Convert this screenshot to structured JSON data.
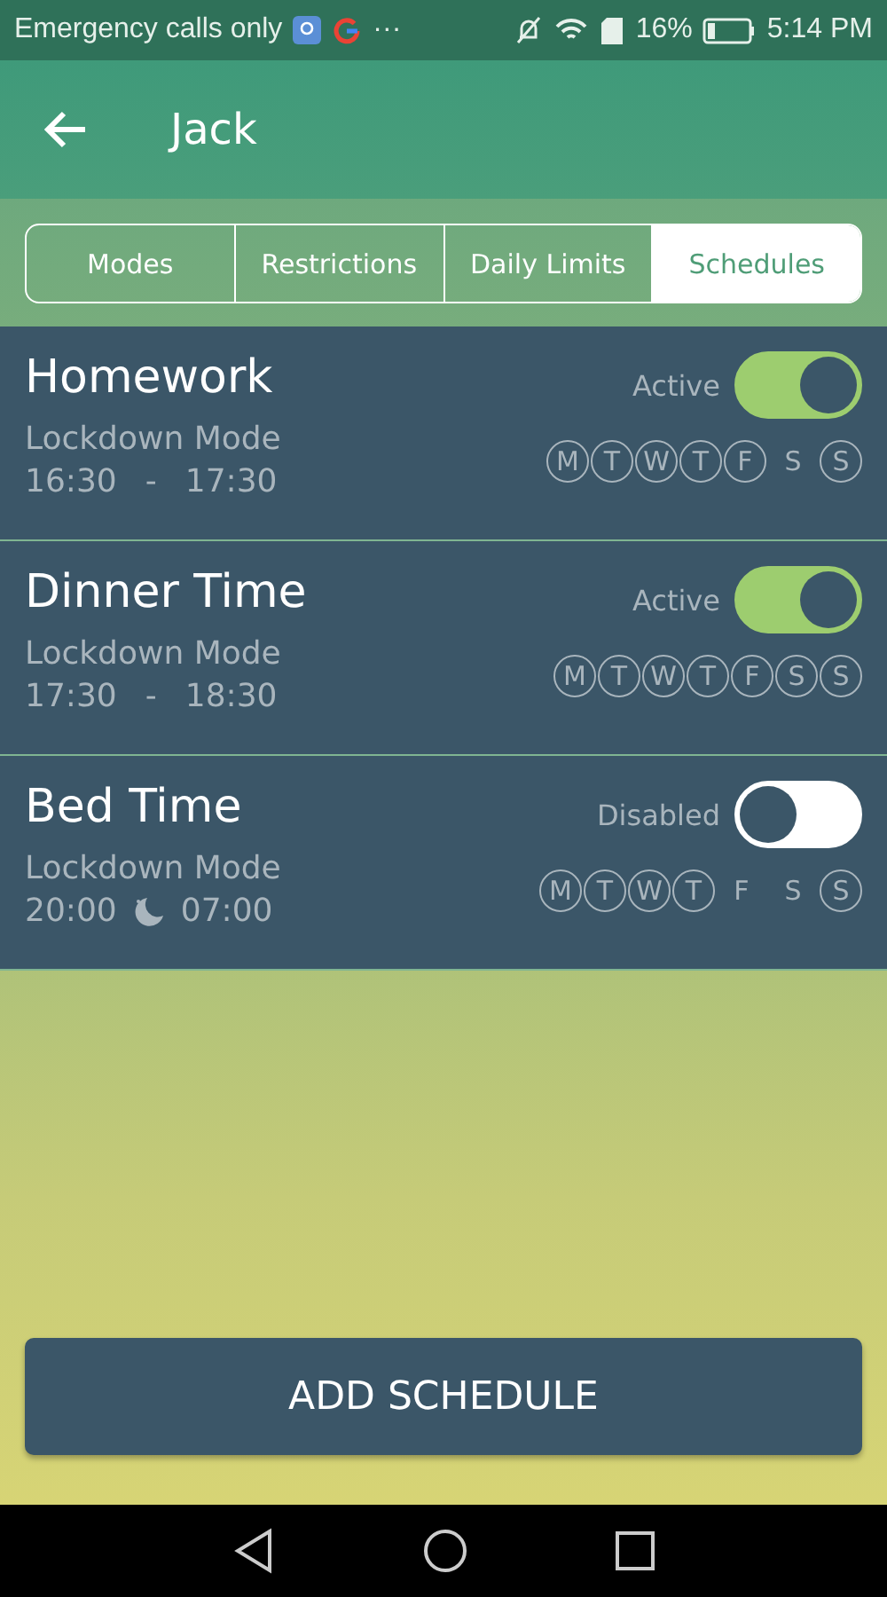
{
  "status_bar": {
    "carrier": "Emergency calls only",
    "more": "···",
    "battery_percent": "16%",
    "time": "5:14 PM"
  },
  "header": {
    "title": "Jack"
  },
  "tabs": [
    {
      "label": "Modes",
      "selected": false
    },
    {
      "label": "Restrictions",
      "selected": false
    },
    {
      "label": "Daily Limits",
      "selected": false
    },
    {
      "label": "Schedules",
      "selected": true
    }
  ],
  "schedules": [
    {
      "name": "Homework",
      "status": "Active",
      "on": true,
      "mode": "Lockdown Mode",
      "start": "16:30",
      "end": "17:30",
      "overnight": false,
      "separator": "-",
      "days": [
        {
          "label": "M",
          "selected": true
        },
        {
          "label": "T",
          "selected": true
        },
        {
          "label": "W",
          "selected": true
        },
        {
          "label": "T",
          "selected": true
        },
        {
          "label": "F",
          "selected": true
        },
        {
          "label": "S",
          "selected": false
        },
        {
          "label": "S",
          "selected": true
        }
      ]
    },
    {
      "name": "Dinner Time",
      "status": "Active",
      "on": true,
      "mode": "Lockdown Mode",
      "start": "17:30",
      "end": "18:30",
      "overnight": false,
      "separator": "-",
      "days": [
        {
          "label": "M",
          "selected": true
        },
        {
          "label": "T",
          "selected": true
        },
        {
          "label": "W",
          "selected": true
        },
        {
          "label": "T",
          "selected": true
        },
        {
          "label": "F",
          "selected": true
        },
        {
          "label": "S",
          "selected": true
        },
        {
          "label": "S",
          "selected": true
        }
      ]
    },
    {
      "name": "Bed Time",
      "status": "Disabled",
      "on": false,
      "mode": "Lockdown Mode",
      "start": "20:00",
      "end": "07:00",
      "overnight": true,
      "days": [
        {
          "label": "M",
          "selected": true
        },
        {
          "label": "T",
          "selected": true
        },
        {
          "label": "W",
          "selected": true
        },
        {
          "label": "T",
          "selected": true
        },
        {
          "label": "F",
          "selected": false
        },
        {
          "label": "S",
          "selected": false
        },
        {
          "label": "S",
          "selected": true
        }
      ]
    }
  ],
  "add_button": {
    "label": "ADD SCHEDULE"
  }
}
